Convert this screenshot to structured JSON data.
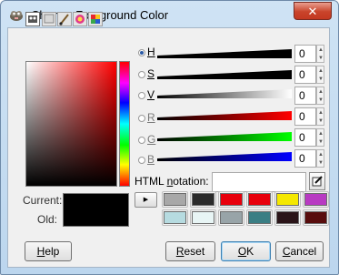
{
  "window": {
    "title": "Change Foreground Color",
    "close_label": "✕"
  },
  "tabs": [
    {
      "icon": "gimp-picker-icon",
      "active": true
    },
    {
      "icon": "cmyk-icon",
      "active": false
    },
    {
      "icon": "watercolor-brush-icon",
      "active": false
    },
    {
      "icon": "color-wheel-icon",
      "active": false
    },
    {
      "icon": "palette-icon",
      "active": false
    }
  ],
  "channels": [
    {
      "key": "h",
      "label": "H",
      "value": "0",
      "selected": true
    },
    {
      "key": "s",
      "label": "S",
      "value": "0",
      "selected": false
    },
    {
      "key": "v",
      "label": "V",
      "value": "0",
      "selected": false
    },
    {
      "key": "r",
      "label": "R",
      "value": "0",
      "selected": false
    },
    {
      "key": "g",
      "label": "G",
      "value": "0",
      "selected": false
    },
    {
      "key": "b",
      "label": "B",
      "value": "0",
      "selected": false
    }
  ],
  "html_notation": {
    "label_before": "HTML ",
    "label_mnemonic": "n",
    "label_after": "otation:",
    "value": ""
  },
  "preview": {
    "current_label": "Current:",
    "old_label": "Old:",
    "current_color": "#000000",
    "old_color": "#000000"
  },
  "history_colors": [
    "#a8a8a8",
    "#2a2a2a",
    "#e8000c",
    "#e8000c",
    "#f5e800",
    "#b83ac2",
    "#b6dbe0",
    "#e8f5f5",
    "#98a4a8",
    "#3a7e84",
    "#2a1418",
    "#580c0c"
  ],
  "buttons": {
    "help": {
      "mnemonic": "H",
      "rest": "elp"
    },
    "reset": {
      "mnemonic": "R",
      "rest": "eset"
    },
    "ok": {
      "mnemonic": "O",
      "rest": "K"
    },
    "cancel": {
      "mnemonic": "C",
      "rest": "ancel"
    }
  }
}
